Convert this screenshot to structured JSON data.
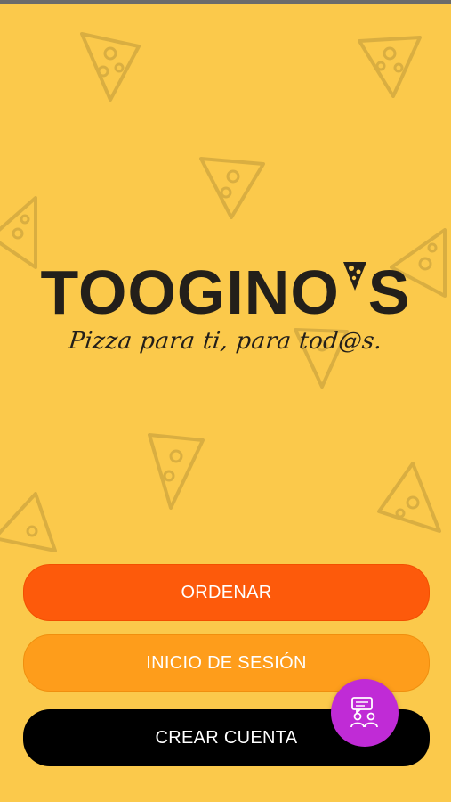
{
  "brand": {
    "name_prefix": "TOOGINO",
    "name_suffix": "S",
    "tagline": "Pizza para ti, para tod@s."
  },
  "buttons": {
    "order_label": "ORDENAR",
    "login_label": "INICIO DE SESIÓN",
    "create_label": "CREAR CUENTA"
  },
  "fab": {
    "icon": "chat-people-icon"
  },
  "colors": {
    "background": "#fbc94b",
    "order": "#fd5a0b",
    "login": "#fe9d1b",
    "create": "#000000",
    "fab": "#c02bd6",
    "text_dark": "#231f1a"
  }
}
